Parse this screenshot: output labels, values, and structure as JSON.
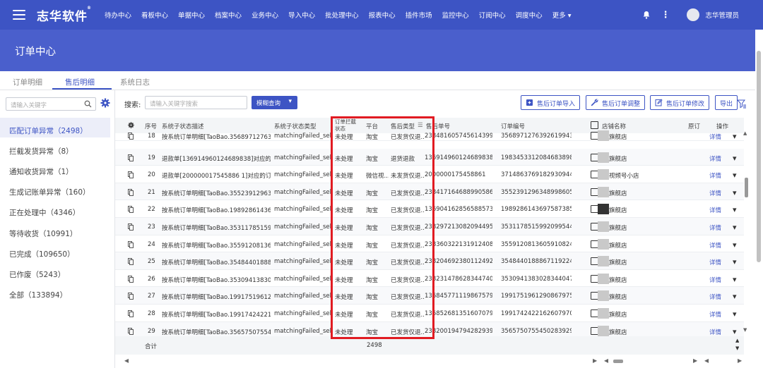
{
  "app": {
    "brand": "志华软件",
    "brand_mark": "®",
    "user_name": "志华管理员"
  },
  "nav": {
    "items": [
      "待办中心",
      "看板中心",
      "单据中心",
      "档案中心",
      "业务中心",
      "导入中心",
      "批处理中心",
      "报表中心",
      "插件市场",
      "监控中心",
      "订阅中心",
      "调度中心"
    ],
    "more_label": "更多"
  },
  "page": {
    "title": "订单中心"
  },
  "tabs": [
    {
      "label": "订单明细"
    },
    {
      "label": "售后明细",
      "active": true
    },
    {
      "label": "系统日志"
    }
  ],
  "sidebar": {
    "search_placeholder": "请输入关键字",
    "categories": [
      {
        "label": "匹配订单异常（2498）",
        "active": true
      },
      {
        "label": "拦截发货异常（8）"
      },
      {
        "label": "通知收货异常（1）"
      },
      {
        "label": "生成记账单异常（160）"
      },
      {
        "label": "正在处理中（4346）"
      },
      {
        "label": "等待收货（10991）"
      },
      {
        "label": "已完成（109650）"
      },
      {
        "label": "已作废（5243）"
      },
      {
        "label": "全部（133894）"
      }
    ]
  },
  "toolbar": {
    "search_label": "搜索:",
    "search_placeholder": "请输入关键字搜索",
    "fuzzy_button": "模糊查询",
    "import_button": "售后订单导入",
    "adjust_button": "售后订单调整",
    "modify_button": "售后订单修改",
    "export_button": "导出"
  },
  "table": {
    "columns": {
      "seq": "序号",
      "sub_desc": "系统子状态描述",
      "sub_type": "系统子状态类型",
      "intercept": "订单拦截状态",
      "platform": "平台",
      "after_type": "售后类型",
      "after_no": "售后单号",
      "order_no": "订单编号",
      "shop": "店铺名称",
      "orig": "原订",
      "op": "操作"
    },
    "rows": [
      {
        "seq": "18",
        "desc": "按系统订单明细[TaoBao.35689712763...",
        "type": "matchingFailed_sell...",
        "intercept": "未处理",
        "platform": "淘宝",
        "after_type": "已发货仅退...",
        "after_no": "238481605745614399",
        "order_no": "3568971276392619943",
        "shop": "旗舰店",
        "op": "详情"
      },
      {
        "seq": "19",
        "desc": "退款单[136914960124689838]对应的...",
        "type": "matchingFailed_sell...",
        "intercept": "未处理",
        "platform": "淘宝",
        "after_type": "退货退款",
        "after_no": "136914960124689838",
        "order_no": "1983453312084683898",
        "shop": "旗舰店",
        "op": "详情"
      },
      {
        "seq": "20",
        "desc": "退款单[200000017545886 1]对应的订...",
        "type": "matchingFailed_sell...",
        "intercept": "未处理",
        "platform": "微信视...",
        "after_type": "未发货仅退...",
        "after_no": "2000000175458861",
        "order_no": "3714863769182930944",
        "shop": "视频号小店",
        "op": "详情"
      },
      {
        "seq": "21",
        "desc": "按系统订单明细[TaoBao.35523912963...",
        "type": "matchingFailed_sell...",
        "intercept": "未处理",
        "platform": "淘宝",
        "after_type": "已发货仅退...",
        "after_no": "238417164688990586",
        "order_no": "3552391296348998605",
        "shop": "旗舰店",
        "op": "详情"
      },
      {
        "seq": "22",
        "desc": "按系统订单明细[TaoBao.19892861436...",
        "type": "matchingFailed_sell...",
        "intercept": "未处理",
        "platform": "淘宝",
        "after_type": "已发货仅退...",
        "after_no": "136904162856588573",
        "order_no": "1989286143697587385",
        "shop": "旗舰店",
        "op": "详情"
      },
      {
        "seq": "23",
        "desc": "按系统订单明细[TaoBao.35311785159...",
        "type": "matchingFailed_sell...",
        "intercept": "未处理",
        "platform": "淘宝",
        "after_type": "已发货仅退...",
        "after_no": "238297213082094495",
        "order_no": "3531178515992099544",
        "shop": "旗舰店",
        "op": "详情"
      },
      {
        "seq": "24",
        "desc": "按系统订单明细[TaoBao.35591208136...",
        "type": "matchingFailed_sell...",
        "intercept": "未处理",
        "platform": "淘宝",
        "after_type": "已发货仅退...",
        "after_no": "238360322131912408",
        "order_no": "3559120813605910824",
        "shop": "旗舰店",
        "op": "详情"
      },
      {
        "seq": "25",
        "desc": "按系统订单明细[TaoBao.35484401888...",
        "type": "matchingFailed_sell...",
        "intercept": "未处理",
        "platform": "淘宝",
        "after_type": "已发货仅退...",
        "after_no": "238204692380112492",
        "order_no": "3548440188867119224",
        "shop": "旗舰店",
        "op": "详情"
      },
      {
        "seq": "26",
        "desc": "按系统订单明细[TaoBao.35309413830...",
        "type": "matchingFailed_sell...",
        "intercept": "未处理",
        "platform": "淘宝",
        "after_type": "已发货仅退...",
        "after_no": "238231478628344740",
        "order_no": "3530941383028344047",
        "shop": "旗舰店",
        "op": "详情"
      },
      {
        "seq": "27",
        "desc": "按系统订单明细[TaoBao.19917519612...",
        "type": "matchingFailed_sell...",
        "intercept": "未处理",
        "platform": "淘宝",
        "after_type": "已发货仅退...",
        "after_no": "136845771119867579",
        "order_no": "1991751961290867975",
        "shop": "旗舰店",
        "op": "详情"
      },
      {
        "seq": "28",
        "desc": "按系统订单明细[TaoBao.19917424221...",
        "type": "matchingFailed_sell...",
        "intercept": "未处理",
        "platform": "淘宝",
        "after_type": "已发货仅退...",
        "after_no": "136852681351607079",
        "order_no": "1991742422162607970",
        "shop": "旗舰店",
        "op": "详情"
      },
      {
        "seq": "29",
        "desc": "按系统订单明细[TaoBao.35657507554...",
        "type": "matchingFailed_sell...",
        "intercept": "未处理",
        "platform": "淘宝",
        "after_type": "已发货仅退...",
        "after_no": "238200194794282939",
        "order_no": "3565750755450283929",
        "shop": "旗舰店",
        "op": "详情"
      }
    ],
    "footer": {
      "total_label": "合计",
      "total_value": "2498"
    }
  },
  "colors": {
    "brand_blue": "#3d54c4",
    "highlight_red": "#e11b22"
  }
}
